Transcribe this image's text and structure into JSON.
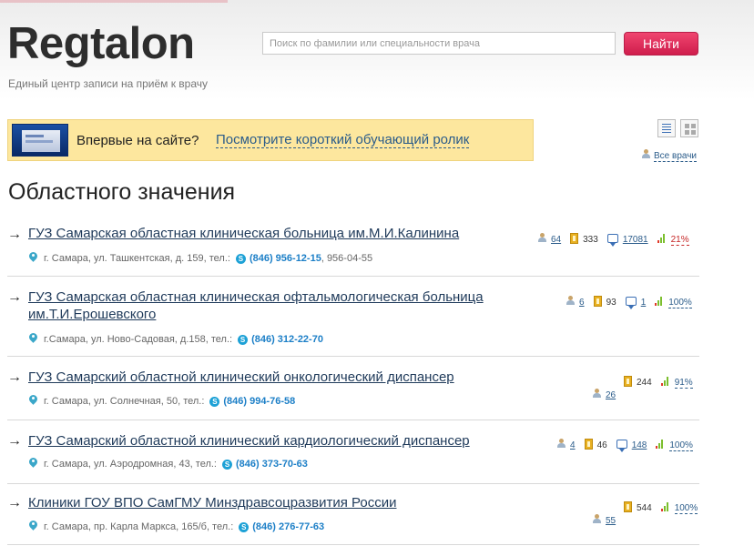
{
  "header": {
    "logo": "Regtalon",
    "tagline": "Единый центр записи на приём к врачу",
    "search_placeholder": "Поиск по фамилии или специальности врача",
    "search_button": "Найти"
  },
  "promo": {
    "question": "Впервые на сайте?",
    "link": "Посмотрите короткий обучающий ролик"
  },
  "view": {
    "all_doctors": "Все врачи"
  },
  "section_title": "Областного значения",
  "clinics": [
    {
      "name_lines": [
        "ГУЗ Самарская областная клиническая больница им.М.И.Калинина"
      ],
      "address": "г. Самара, ул. Ташкентская, д. 159, тел.:",
      "phone": "(846) 956-12-15",
      "phone_extra": ", 956-04-55",
      "doctors": "64",
      "tickets": "333",
      "reviews": "17081",
      "rating": "21%"
    },
    {
      "name_lines": [
        "ГУЗ Самарская областная клиническая офтальмологическая больница",
        "им.Т.И.Ерошевского"
      ],
      "address": "г.Самара, ул. Ново-Садовая, д.158, тел.:",
      "phone": "(846) 312-22-70",
      "phone_extra": "",
      "doctors": "6",
      "tickets": "93",
      "reviews": "1",
      "rating": "100%"
    },
    {
      "name_lines": [
        "ГУЗ Самарский областной клинический онкологический диспансер"
      ],
      "address": "г. Самара, ул. Солнечная, 50, тел.:",
      "phone": "(846) 994-76-58",
      "phone_extra": "",
      "doctors": "26",
      "tickets": "244",
      "reviews": "",
      "rating": "91%"
    },
    {
      "name_lines": [
        "ГУЗ Самарский областной клинический кардиологический диспансер"
      ],
      "address": "г. Самара, ул. Аэродромная, 43, тел.:",
      "phone": "(846) 373-70-63",
      "phone_extra": "",
      "doctors": "4",
      "tickets": "46",
      "reviews": "148",
      "rating": "100%"
    },
    {
      "name_lines": [
        "Клиники ГОУ ВПО СамГМУ Минздравсоцразвития России"
      ],
      "address": "г. Самара, пр. Карла Маркса, 165/б, тел.:",
      "phone": "(846) 276-77-63",
      "phone_extra": "",
      "doctors": "55",
      "tickets": "544",
      "reviews": "",
      "rating": "100%"
    }
  ],
  "icons": [
    "person-icon",
    "ticket-icon",
    "comment-icon",
    "rating-bars-icon",
    "map-pin-icon",
    "skype-icon",
    "list-view-icon",
    "grid-view-icon"
  ]
}
